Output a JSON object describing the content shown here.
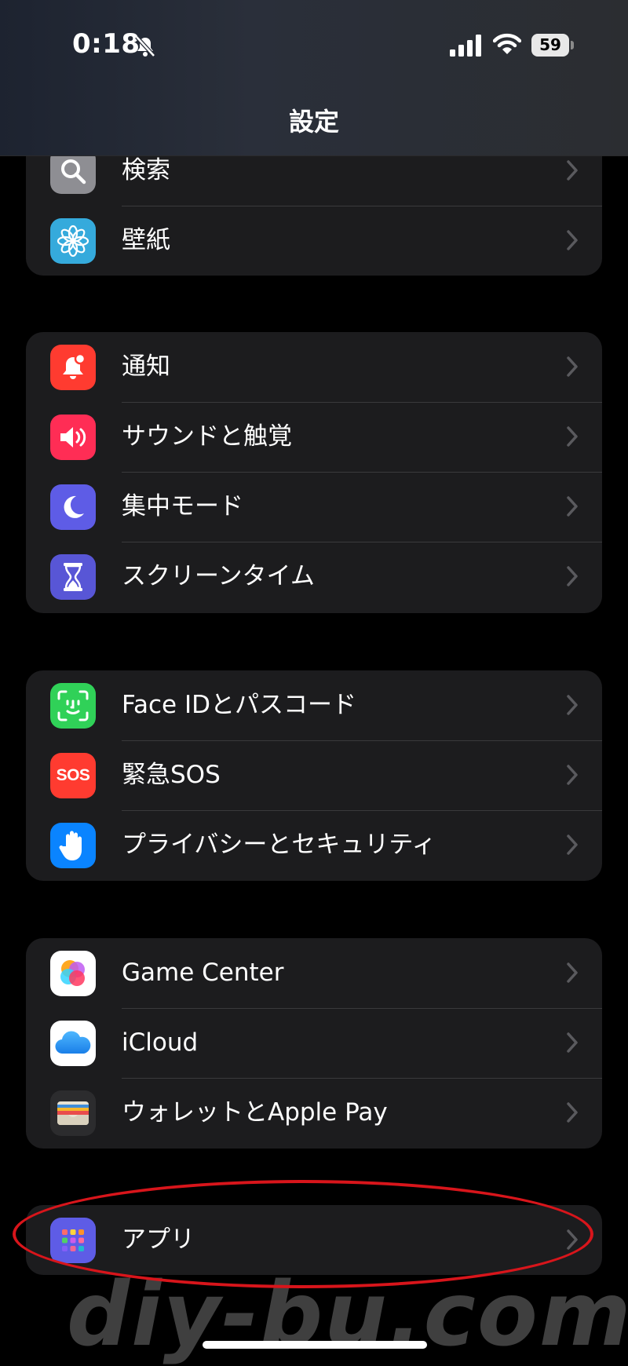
{
  "status_bar": {
    "time": "0:18",
    "battery": "59"
  },
  "nav": {
    "title": "設定"
  },
  "groups": [
    {
      "items": [
        {
          "label": "検索",
          "icon": "search-icon",
          "color": "#8e8e93"
        },
        {
          "label": "壁紙",
          "icon": "flower-icon",
          "color": "#35aadc"
        }
      ]
    },
    {
      "items": [
        {
          "label": "通知",
          "icon": "bell-badge-icon",
          "color": "#ff3b30"
        },
        {
          "label": "サウンドと触覚",
          "icon": "speaker-icon",
          "color": "#ff2d55"
        },
        {
          "label": "集中モード",
          "icon": "moon-icon",
          "color": "#5e5ce6"
        },
        {
          "label": "スクリーンタイム",
          "icon": "hourglass-icon",
          "color": "#5856d6"
        }
      ]
    },
    {
      "items": [
        {
          "label": "Face IDとパスコード",
          "icon": "face-id-icon",
          "color": "#30d158"
        },
        {
          "label": "緊急SOS",
          "icon": "sos-icon",
          "color": "#ff3b30"
        },
        {
          "label": "プライバシーとセキュリティ",
          "icon": "hand-icon",
          "color": "#0a84ff"
        }
      ]
    },
    {
      "items": [
        {
          "label": "Game Center",
          "icon": "game-center-icon",
          "color": "#ffffff"
        },
        {
          "label": "iCloud",
          "icon": "cloud-icon",
          "color": "#ffffff"
        },
        {
          "label": "ウォレットとApple Pay",
          "icon": "wallet-icon",
          "color": "#2c2c2e"
        }
      ]
    },
    {
      "items": [
        {
          "label": "アプリ",
          "icon": "apps-grid-icon",
          "color": "#5e5ce6"
        }
      ]
    }
  ],
  "sos_text": "SOS",
  "watermark": "diy-bu.com",
  "highlight_color": "#d8151b"
}
